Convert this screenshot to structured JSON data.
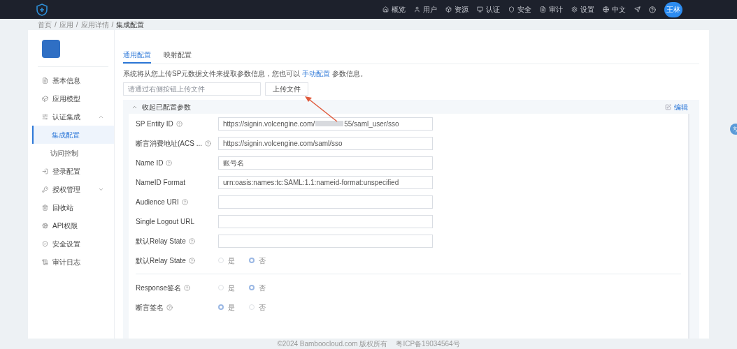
{
  "top_nav": {
    "items": [
      {
        "label": "概览"
      },
      {
        "label": "用户"
      },
      {
        "label": "资源"
      },
      {
        "label": "认证"
      },
      {
        "label": "安全"
      },
      {
        "label": "审计"
      },
      {
        "label": "设置"
      },
      {
        "label": "中文"
      }
    ],
    "avatar": "王林"
  },
  "breadcrumb": {
    "separator": "/",
    "items": [
      "首页",
      "应用",
      "应用详情",
      "集成配置"
    ]
  },
  "sidebar": {
    "items": [
      {
        "label": "基本信息",
        "selected": false
      },
      {
        "label": "应用模型",
        "selected": false
      },
      {
        "label": "认证集成",
        "selected": false,
        "expanded": true,
        "children": [
          {
            "label": "集成配置",
            "selected": true
          },
          {
            "label": "访问控制",
            "selected": false
          }
        ]
      },
      {
        "label": "登录配置",
        "selected": false
      },
      {
        "label": "授权管理",
        "selected": false,
        "expanded": false
      },
      {
        "label": "回收站",
        "selected": false
      },
      {
        "label": "API权限",
        "selected": false
      },
      {
        "label": "安全设置",
        "selected": false
      },
      {
        "label": "审计日志",
        "selected": false
      }
    ]
  },
  "tabs": [
    {
      "label": "通用配置",
      "selected": true
    },
    {
      "label": "映射配置",
      "selected": false
    }
  ],
  "intro": {
    "before": "系统将从您上传SP元数据文件来提取参数信息，您也可以",
    "link": "手动配置",
    "after": "参数信息。"
  },
  "upload": {
    "placeholder": "请通过右侧按钮上传文件",
    "button": "上传文件"
  },
  "section": {
    "title": "收起已配置参数",
    "expanded": true,
    "action": "编辑"
  },
  "fields": [
    {
      "kind": "input",
      "label": "SP Entity ID",
      "help": true,
      "value": "https://signin.volcengine.com/",
      "value_tail": "55/saml_user/sso"
    },
    {
      "kind": "input",
      "label": "断言消费地址(ACS ...",
      "help": true,
      "value": "https://signin.volcengine.com/saml/sso"
    },
    {
      "kind": "input",
      "label": "Name ID",
      "help": true,
      "value": "账号名"
    },
    {
      "kind": "input",
      "label": "NameID Format",
      "help": false,
      "value": "urn:oasis:names:tc:SAML:1.1:nameid-format:unspecified"
    },
    {
      "kind": "input",
      "label": "Audience URI",
      "help": true
    },
    {
      "kind": "input",
      "label": "Single Logout URL",
      "help": false
    },
    {
      "kind": "input",
      "label": "默认Relay State",
      "help": true
    },
    {
      "kind": "radio",
      "label": "默认Relay State",
      "help": true,
      "options": [
        {
          "label": "是",
          "selected": false
        },
        {
          "label": "否",
          "selected": true
        }
      ]
    },
    {
      "kind": "divider"
    },
    {
      "kind": "radio",
      "label": "Response签名",
      "help": true,
      "options": [
        {
          "label": "是",
          "selected": false
        },
        {
          "label": "否",
          "selected": true
        }
      ]
    },
    {
      "kind": "radio",
      "label": "断言签名",
      "help": true,
      "options": [
        {
          "label": "是",
          "selected": true
        },
        {
          "label": "否",
          "selected": false
        }
      ]
    }
  ],
  "footer": {
    "copyright": "©2024 Bamboocloud.com 版权所有",
    "icp": "粤ICP备19034564号"
  }
}
